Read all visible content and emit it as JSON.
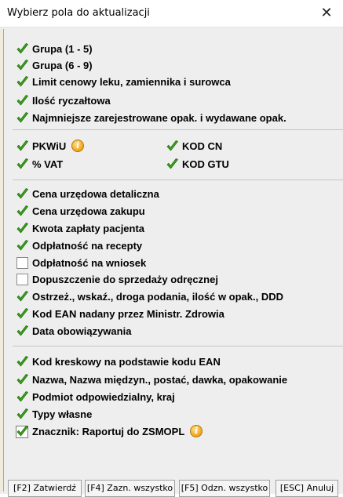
{
  "window": {
    "title": "Wybierz pola do aktualizacji",
    "close_glyph": "✕"
  },
  "groups": [
    {
      "items": [
        {
          "label": "Grupa (1 - 5)",
          "checked": true
        },
        {
          "label": "Grupa (6 - 9)",
          "checked": true
        },
        {
          "label": "Limit cenowy leku, zamiennika i surowca",
          "checked": true
        },
        {
          "label": "Ilość ryczałtowa",
          "checked": true
        },
        {
          "label": "Najmniejsze zarejestrowane opak. i wydawane opak.",
          "checked": true
        }
      ]
    },
    {
      "items": [
        {
          "label": "PKWiU",
          "checked": true,
          "info_icon": true
        },
        {
          "label": "% VAT",
          "checked": true
        },
        {
          "label": "KOD CN",
          "checked": true
        },
        {
          "label": "KOD GTU",
          "checked": true
        }
      ]
    },
    {
      "items": [
        {
          "label": "Cena urzędowa detaliczna",
          "checked": true
        },
        {
          "label": "Cena urzędowa zakupu",
          "checked": true
        },
        {
          "label": "Kwota zapłaty pacjenta",
          "checked": true
        },
        {
          "label": "Odpłatność na recepty",
          "checked": true
        },
        {
          "label": "Odpłatność na wniosek",
          "checked": false
        },
        {
          "label": "Dopuszczenie do sprzedaży odręcznej",
          "checked": false
        },
        {
          "label": "Ostrzeż., wskaź., droga podania, ilość w opak., DDD",
          "checked": true
        },
        {
          "label": "Kod EAN nadany przez Ministr. Zdrowia",
          "checked": true
        },
        {
          "label": "Data obowiązywania",
          "checked": true
        }
      ]
    },
    {
      "items": [
        {
          "label": "Kod kreskowy na podstawie kodu EAN",
          "checked": true
        },
        {
          "label": "Nazwa, Nazwa międzyn., postać, dawka, opakowanie",
          "checked": true
        },
        {
          "label": "Podmiot odpowiedzialny, kraj",
          "checked": true
        },
        {
          "label": "Typy własne",
          "checked": true
        },
        {
          "label": "Znacznik: Raportuj do ZSMOPL",
          "checked": true,
          "info_icon": true,
          "focused": true
        }
      ]
    }
  ],
  "info_icon_glyph": "i",
  "buttons": {
    "confirm": "[F2] Zatwierdź",
    "select_all": "[F4] Zazn. wszystko",
    "deselect_all": "[F5] Odzn. wszystko",
    "cancel": "[ESC] Anuluj"
  },
  "colors": {
    "check_green": "#3ca21b",
    "info_orange": "#f0a21a"
  }
}
